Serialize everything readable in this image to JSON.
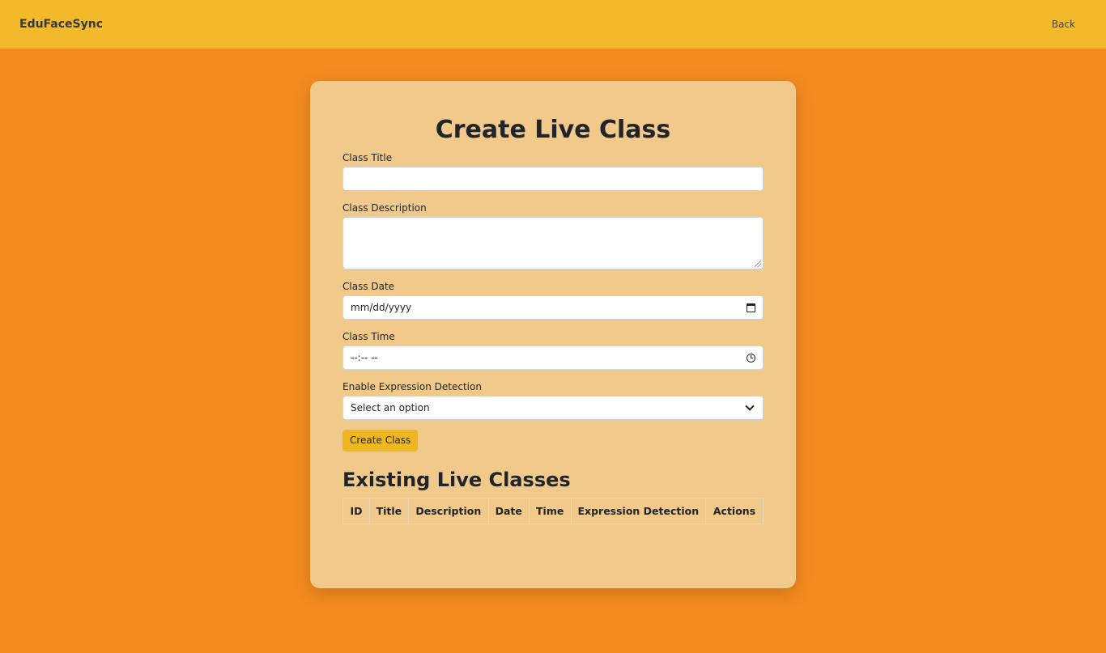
{
  "navbar": {
    "brand": "EduFaceSync",
    "back_label": "Back"
  },
  "form": {
    "title": "Create Live Class",
    "class_title_label": "Class Title",
    "class_title_value": "",
    "class_description_label": "Class Description",
    "class_description_value": "",
    "class_date_label": "Class Date",
    "class_date_placeholder": "mm/dd/yyyy",
    "class_time_label": "Class Time",
    "class_time_placeholder": "--:-- --",
    "expression_label": "Enable Expression Detection",
    "expression_selected": "Select an option",
    "submit_label": "Create Class"
  },
  "existing": {
    "title": "Existing Live Classes",
    "columns": [
      "ID",
      "Title",
      "Description",
      "Date",
      "Time",
      "Expression Detection",
      "Actions"
    ],
    "rows": []
  },
  "colors": {
    "page_background": "#f48b1f",
    "navbar_background": "#f2b92a",
    "card_background": "#f1c98a",
    "button_background": "#eeb61f"
  },
  "icons": [
    "calendar-icon",
    "clock-icon",
    "chevron-down-icon"
  ]
}
